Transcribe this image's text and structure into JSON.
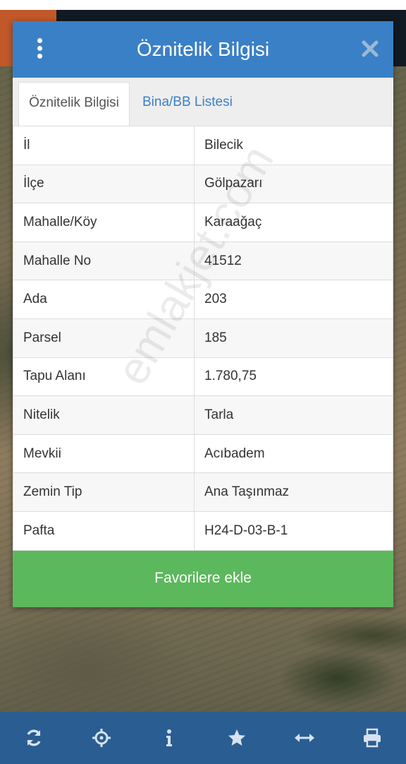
{
  "dialog": {
    "title": "Öznitelik Bilgisi",
    "tabs": [
      {
        "label": "Öznitelik Bilgisi",
        "active": true
      },
      {
        "label": "Bina/BB Listesi",
        "active": false
      }
    ],
    "rows": [
      {
        "key": "İl",
        "value": "Bilecik"
      },
      {
        "key": "İlçe",
        "value": "Gölpazarı"
      },
      {
        "key": "Mahalle/Köy",
        "value": "Karaağaç"
      },
      {
        "key": "Mahalle No",
        "value": "41512"
      },
      {
        "key": "Ada",
        "value": "203"
      },
      {
        "key": "Parsel",
        "value": "185"
      },
      {
        "key": "Tapu Alanı",
        "value": "1.780,75"
      },
      {
        "key": "Nitelik",
        "value": "Tarla"
      },
      {
        "key": "Mevkii",
        "value": "Acıbadem"
      },
      {
        "key": "Zemin Tip",
        "value": "Ana Taşınmaz"
      },
      {
        "key": "Pafta",
        "value": "H24-D-03-B-1"
      }
    ],
    "favorite_label": "Favorilere ekle"
  },
  "watermark": "emlakjet.com",
  "toolbar": {
    "icons": [
      "refresh-icon",
      "locate-icon",
      "info-icon",
      "star-icon",
      "measure-icon",
      "print-icon"
    ]
  },
  "colors": {
    "header": "#3a80c6",
    "favorite": "#5cb85c",
    "toolbar": "#2a5d92",
    "tab_link": "#3a80c6"
  }
}
